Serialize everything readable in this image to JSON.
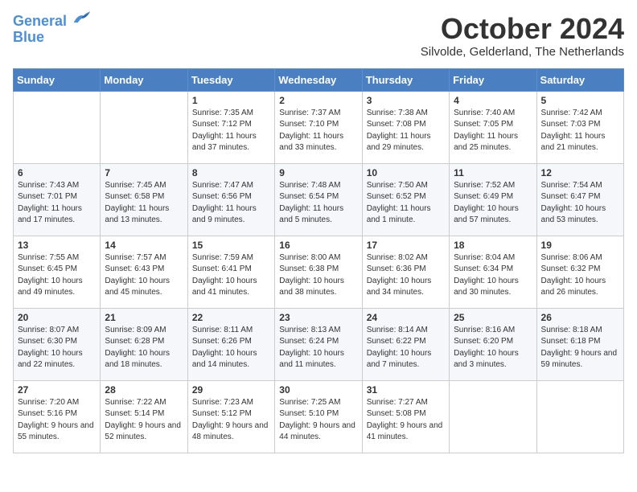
{
  "header": {
    "logo_line1": "General",
    "logo_line2": "Blue",
    "month_title": "October 2024",
    "subtitle": "Silvolde, Gelderland, The Netherlands"
  },
  "days_of_week": [
    "Sunday",
    "Monday",
    "Tuesday",
    "Wednesday",
    "Thursday",
    "Friday",
    "Saturday"
  ],
  "weeks": [
    [
      {
        "day": "",
        "info": ""
      },
      {
        "day": "",
        "info": ""
      },
      {
        "day": "1",
        "info": "Sunrise: 7:35 AM\nSunset: 7:12 PM\nDaylight: 11 hours and 37 minutes."
      },
      {
        "day": "2",
        "info": "Sunrise: 7:37 AM\nSunset: 7:10 PM\nDaylight: 11 hours and 33 minutes."
      },
      {
        "day": "3",
        "info": "Sunrise: 7:38 AM\nSunset: 7:08 PM\nDaylight: 11 hours and 29 minutes."
      },
      {
        "day": "4",
        "info": "Sunrise: 7:40 AM\nSunset: 7:05 PM\nDaylight: 11 hours and 25 minutes."
      },
      {
        "day": "5",
        "info": "Sunrise: 7:42 AM\nSunset: 7:03 PM\nDaylight: 11 hours and 21 minutes."
      }
    ],
    [
      {
        "day": "6",
        "info": "Sunrise: 7:43 AM\nSunset: 7:01 PM\nDaylight: 11 hours and 17 minutes."
      },
      {
        "day": "7",
        "info": "Sunrise: 7:45 AM\nSunset: 6:58 PM\nDaylight: 11 hours and 13 minutes."
      },
      {
        "day": "8",
        "info": "Sunrise: 7:47 AM\nSunset: 6:56 PM\nDaylight: 11 hours and 9 minutes."
      },
      {
        "day": "9",
        "info": "Sunrise: 7:48 AM\nSunset: 6:54 PM\nDaylight: 11 hours and 5 minutes."
      },
      {
        "day": "10",
        "info": "Sunrise: 7:50 AM\nSunset: 6:52 PM\nDaylight: 11 hours and 1 minute."
      },
      {
        "day": "11",
        "info": "Sunrise: 7:52 AM\nSunset: 6:49 PM\nDaylight: 10 hours and 57 minutes."
      },
      {
        "day": "12",
        "info": "Sunrise: 7:54 AM\nSunset: 6:47 PM\nDaylight: 10 hours and 53 minutes."
      }
    ],
    [
      {
        "day": "13",
        "info": "Sunrise: 7:55 AM\nSunset: 6:45 PM\nDaylight: 10 hours and 49 minutes."
      },
      {
        "day": "14",
        "info": "Sunrise: 7:57 AM\nSunset: 6:43 PM\nDaylight: 10 hours and 45 minutes."
      },
      {
        "day": "15",
        "info": "Sunrise: 7:59 AM\nSunset: 6:41 PM\nDaylight: 10 hours and 41 minutes."
      },
      {
        "day": "16",
        "info": "Sunrise: 8:00 AM\nSunset: 6:38 PM\nDaylight: 10 hours and 38 minutes."
      },
      {
        "day": "17",
        "info": "Sunrise: 8:02 AM\nSunset: 6:36 PM\nDaylight: 10 hours and 34 minutes."
      },
      {
        "day": "18",
        "info": "Sunrise: 8:04 AM\nSunset: 6:34 PM\nDaylight: 10 hours and 30 minutes."
      },
      {
        "day": "19",
        "info": "Sunrise: 8:06 AM\nSunset: 6:32 PM\nDaylight: 10 hours and 26 minutes."
      }
    ],
    [
      {
        "day": "20",
        "info": "Sunrise: 8:07 AM\nSunset: 6:30 PM\nDaylight: 10 hours and 22 minutes."
      },
      {
        "day": "21",
        "info": "Sunrise: 8:09 AM\nSunset: 6:28 PM\nDaylight: 10 hours and 18 minutes."
      },
      {
        "day": "22",
        "info": "Sunrise: 8:11 AM\nSunset: 6:26 PM\nDaylight: 10 hours and 14 minutes."
      },
      {
        "day": "23",
        "info": "Sunrise: 8:13 AM\nSunset: 6:24 PM\nDaylight: 10 hours and 11 minutes."
      },
      {
        "day": "24",
        "info": "Sunrise: 8:14 AM\nSunset: 6:22 PM\nDaylight: 10 hours and 7 minutes."
      },
      {
        "day": "25",
        "info": "Sunrise: 8:16 AM\nSunset: 6:20 PM\nDaylight: 10 hours and 3 minutes."
      },
      {
        "day": "26",
        "info": "Sunrise: 8:18 AM\nSunset: 6:18 PM\nDaylight: 9 hours and 59 minutes."
      }
    ],
    [
      {
        "day": "27",
        "info": "Sunrise: 7:20 AM\nSunset: 5:16 PM\nDaylight: 9 hours and 55 minutes."
      },
      {
        "day": "28",
        "info": "Sunrise: 7:22 AM\nSunset: 5:14 PM\nDaylight: 9 hours and 52 minutes."
      },
      {
        "day": "29",
        "info": "Sunrise: 7:23 AM\nSunset: 5:12 PM\nDaylight: 9 hours and 48 minutes."
      },
      {
        "day": "30",
        "info": "Sunrise: 7:25 AM\nSunset: 5:10 PM\nDaylight: 9 hours and 44 minutes."
      },
      {
        "day": "31",
        "info": "Sunrise: 7:27 AM\nSunset: 5:08 PM\nDaylight: 9 hours and 41 minutes."
      },
      {
        "day": "",
        "info": ""
      },
      {
        "day": "",
        "info": ""
      }
    ]
  ]
}
